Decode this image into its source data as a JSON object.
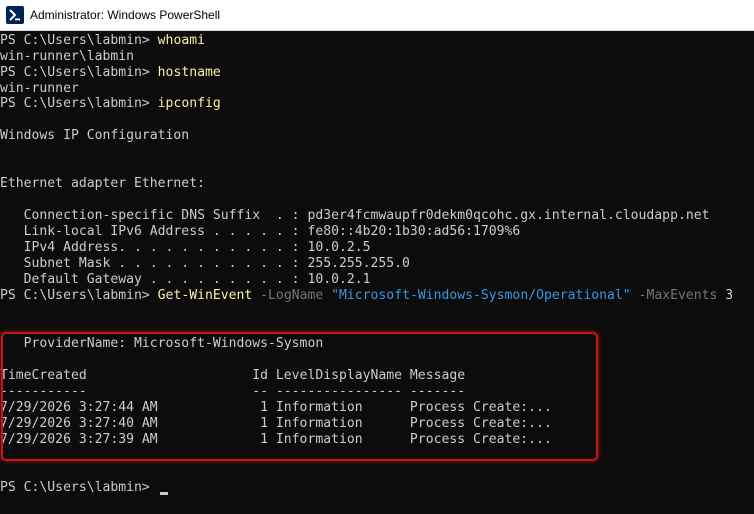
{
  "window": {
    "title": "Administrator: Windows PowerShell",
    "icon": "powershell-icon"
  },
  "colors": {
    "background": "#0c0c0c",
    "text": "#cccccc",
    "command": "#f9f1a5",
    "parameter": "#767676",
    "string": "#3a96dd",
    "highlight_border": "#c8161d"
  },
  "prompt": "PS C:\\Users\\labmin> ",
  "session": {
    "cmd_whoami": "whoami",
    "out_whoami": "win-runner\\labmin",
    "cmd_hostname": "hostname",
    "out_hostname": "win-runner",
    "cmd_ipconfig": "ipconfig",
    "ipconfig_header": "Windows IP Configuration",
    "adapter_header": "Ethernet adapter Ethernet:",
    "ipconfig_rows": [
      "   Connection-specific DNS Suffix  . : pd3er4fcmwaupfr0dekm0qcohc.gx.internal.cloudapp.net",
      "   Link-local IPv6 Address . . . . . : fe80::4b20:1b30:ad56:1709%6",
      "   IPv4 Address. . . . . . . . . . . : 10.0.2.5",
      "   Subnet Mask . . . . . . . . . . . : 255.255.255.0",
      "   Default Gateway . . . . . . . . . : 10.0.2.1"
    ],
    "cmd_winevent": {
      "cmdlet": "Get-WinEvent",
      "param_logname": " -LogName ",
      "logname_value": "\"Microsoft-Windows-Sysmon/Operational\"",
      "param_maxevents": " -MaxEvents ",
      "maxevents_value": "3"
    },
    "event_output": {
      "provider_line": "   ProviderName: Microsoft-Windows-Sysmon",
      "table_header": "TimeCreated                     Id LevelDisplayName Message",
      "table_separator": "-----------                     -- ---------------- -------",
      "rows": [
        "7/29/2026 3:27:44 AM             1 Information      Process Create:...",
        "7/29/2026 3:27:40 AM             1 Information      Process Create:...",
        "7/29/2026 3:27:39 AM             1 Information      Process Create:..."
      ]
    }
  }
}
